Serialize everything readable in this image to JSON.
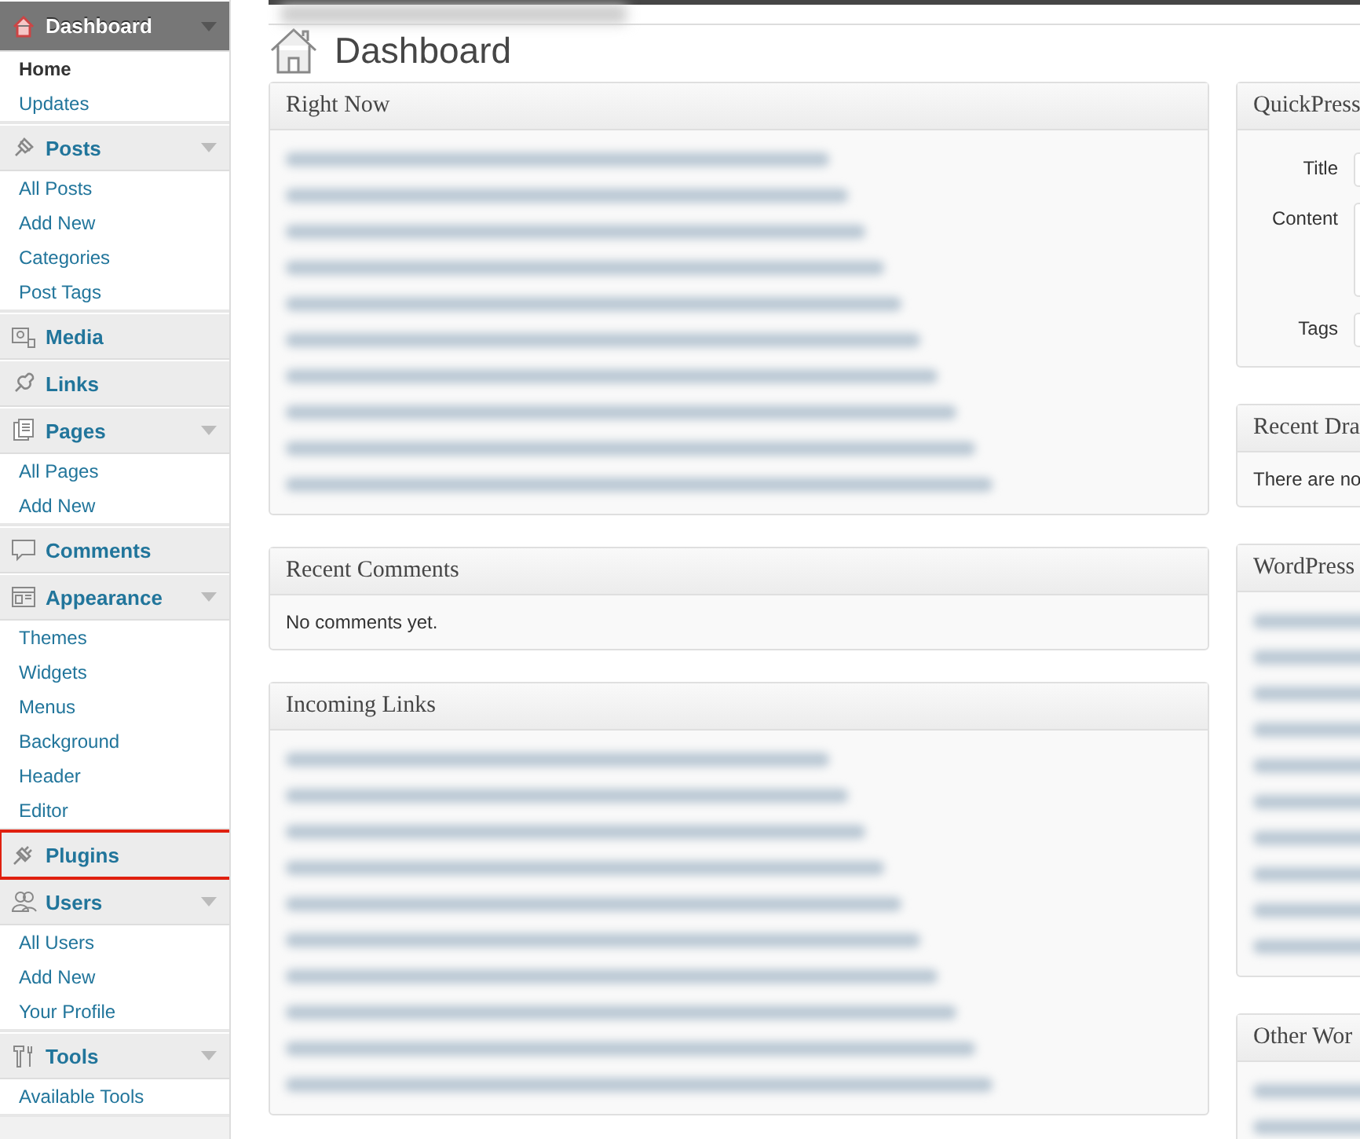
{
  "sidebar": {
    "items": [
      {
        "label": "Dashboard",
        "selected": true,
        "highlighted": false,
        "submenu": [
          {
            "label": "Home",
            "selected": true
          },
          {
            "label": "Updates",
            "selected": false
          }
        ]
      },
      {
        "label": "Posts",
        "selected": false,
        "highlighted": false,
        "submenu": [
          {
            "label": "All Posts",
            "selected": false
          },
          {
            "label": "Add New",
            "selected": false
          },
          {
            "label": "Categories",
            "selected": false
          },
          {
            "label": "Post Tags",
            "selected": false
          }
        ]
      },
      {
        "label": "Media",
        "selected": false,
        "highlighted": false
      },
      {
        "label": "Links",
        "selected": false,
        "highlighted": false
      },
      {
        "label": "Pages",
        "selected": false,
        "highlighted": false,
        "submenu": [
          {
            "label": "All Pages",
            "selected": false
          },
          {
            "label": "Add New",
            "selected": false
          }
        ]
      },
      {
        "label": "Comments",
        "selected": false,
        "highlighted": false
      },
      {
        "label": "Appearance",
        "selected": false,
        "highlighted": false,
        "submenu": [
          {
            "label": "Themes",
            "selected": false
          },
          {
            "label": "Widgets",
            "selected": false
          },
          {
            "label": "Menus",
            "selected": false
          },
          {
            "label": "Background",
            "selected": false
          },
          {
            "label": "Header",
            "selected": false
          },
          {
            "label": "Editor",
            "selected": false
          }
        ]
      },
      {
        "label": "Plugins",
        "selected": false,
        "highlighted": true
      },
      {
        "label": "Users",
        "selected": false,
        "highlighted": false,
        "submenu": [
          {
            "label": "All Users",
            "selected": false
          },
          {
            "label": "Add New",
            "selected": false
          },
          {
            "label": "Your Profile",
            "selected": false
          }
        ]
      },
      {
        "label": "Tools",
        "selected": false,
        "highlighted": false,
        "submenu": [
          {
            "label": "Available Tools",
            "selected": false
          }
        ]
      }
    ]
  },
  "page": {
    "title": "Dashboard"
  },
  "left_widgets": [
    {
      "title": "Right Now",
      "kind": "blurred"
    },
    {
      "title": "Recent Comments",
      "kind": "text",
      "text": "No comments yet."
    },
    {
      "title": "Incoming Links",
      "kind": "blurred"
    }
  ],
  "right_widgets": [
    {
      "title": "QuickPress",
      "kind": "form",
      "fields": [
        {
          "label": "Title",
          "kind": "input"
        },
        {
          "label": "Content",
          "kind": "textarea"
        },
        {
          "label": "Tags",
          "kind": "input"
        }
      ]
    },
    {
      "title": "Recent Dra",
      "kind": "text",
      "text": "There are no"
    },
    {
      "title": "WordPress",
      "kind": "blurred"
    },
    {
      "title": "Other Wor",
      "kind": "blurred"
    }
  ]
}
